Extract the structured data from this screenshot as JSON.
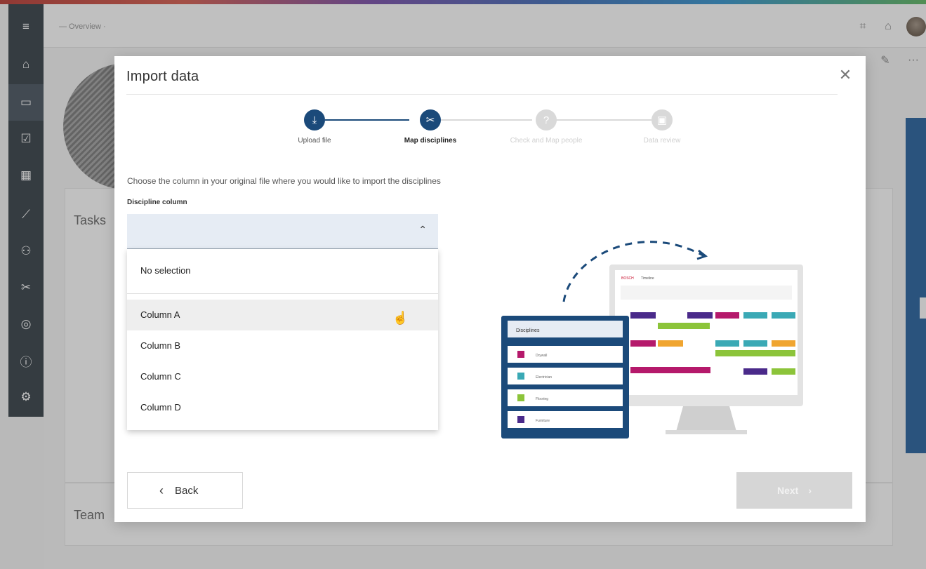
{
  "app": {
    "breadcrumb": "— Overview ·",
    "background_labels": {
      "tasks": "Tasks",
      "team": "Team"
    }
  },
  "sidebar": {
    "items": [
      {
        "icon": "menu-icon",
        "glyph": "≡"
      },
      {
        "icon": "home-icon",
        "glyph": "⌂"
      },
      {
        "icon": "board-icon",
        "glyph": "▭"
      },
      {
        "icon": "checkbox-icon",
        "glyph": "☑"
      },
      {
        "icon": "calendar-icon",
        "glyph": "▦"
      },
      {
        "icon": "chart-icon",
        "glyph": "⟋"
      },
      {
        "icon": "people-icon",
        "glyph": "⚇"
      },
      {
        "icon": "tools-icon",
        "glyph": "✂"
      },
      {
        "icon": "location-icon",
        "glyph": "◎"
      },
      {
        "icon": "info-icon",
        "glyph": "ⓘ"
      },
      {
        "icon": "settings-icon",
        "glyph": "⚙"
      }
    ]
  },
  "modal": {
    "title": "Import data",
    "close_glyph": "✕",
    "steps": [
      {
        "label": "Upload file",
        "state": "done",
        "glyph": "⤓"
      },
      {
        "label": "Map disciplines",
        "state": "active",
        "glyph": "✂"
      },
      {
        "label": "Check and Map people",
        "state": "inactive",
        "glyph": "?"
      },
      {
        "label": "Data review",
        "state": "inactive",
        "glyph": "▣"
      }
    ],
    "instruction": "Choose the column in your original file where you would like to import the disciplines",
    "field_label": "Discipline column",
    "select_value": "",
    "chevron_glyph": "^",
    "options": [
      {
        "label": "No selection"
      },
      {
        "label": "Column A"
      },
      {
        "label": "Column B"
      },
      {
        "label": "Column C"
      },
      {
        "label": "Column D"
      }
    ],
    "back_label": "Back",
    "next_label": "Next"
  },
  "illustration": {
    "list_title": "Disciplines",
    "list_items": [
      "Drywall",
      "Electrician",
      "Flooring",
      "Furniture"
    ],
    "monitor_brand": "BOSCH",
    "monitor_title": "Timeline"
  },
  "colors": {
    "primary": "#0d4f94",
    "dark_step": "#1b4a7a",
    "inactive_step": "#d9d9d9",
    "magenta": "#b5196b",
    "teal": "#3aa9b5",
    "green": "#8cc43a",
    "purple": "#4a2a8a",
    "orange": "#f0a530"
  }
}
